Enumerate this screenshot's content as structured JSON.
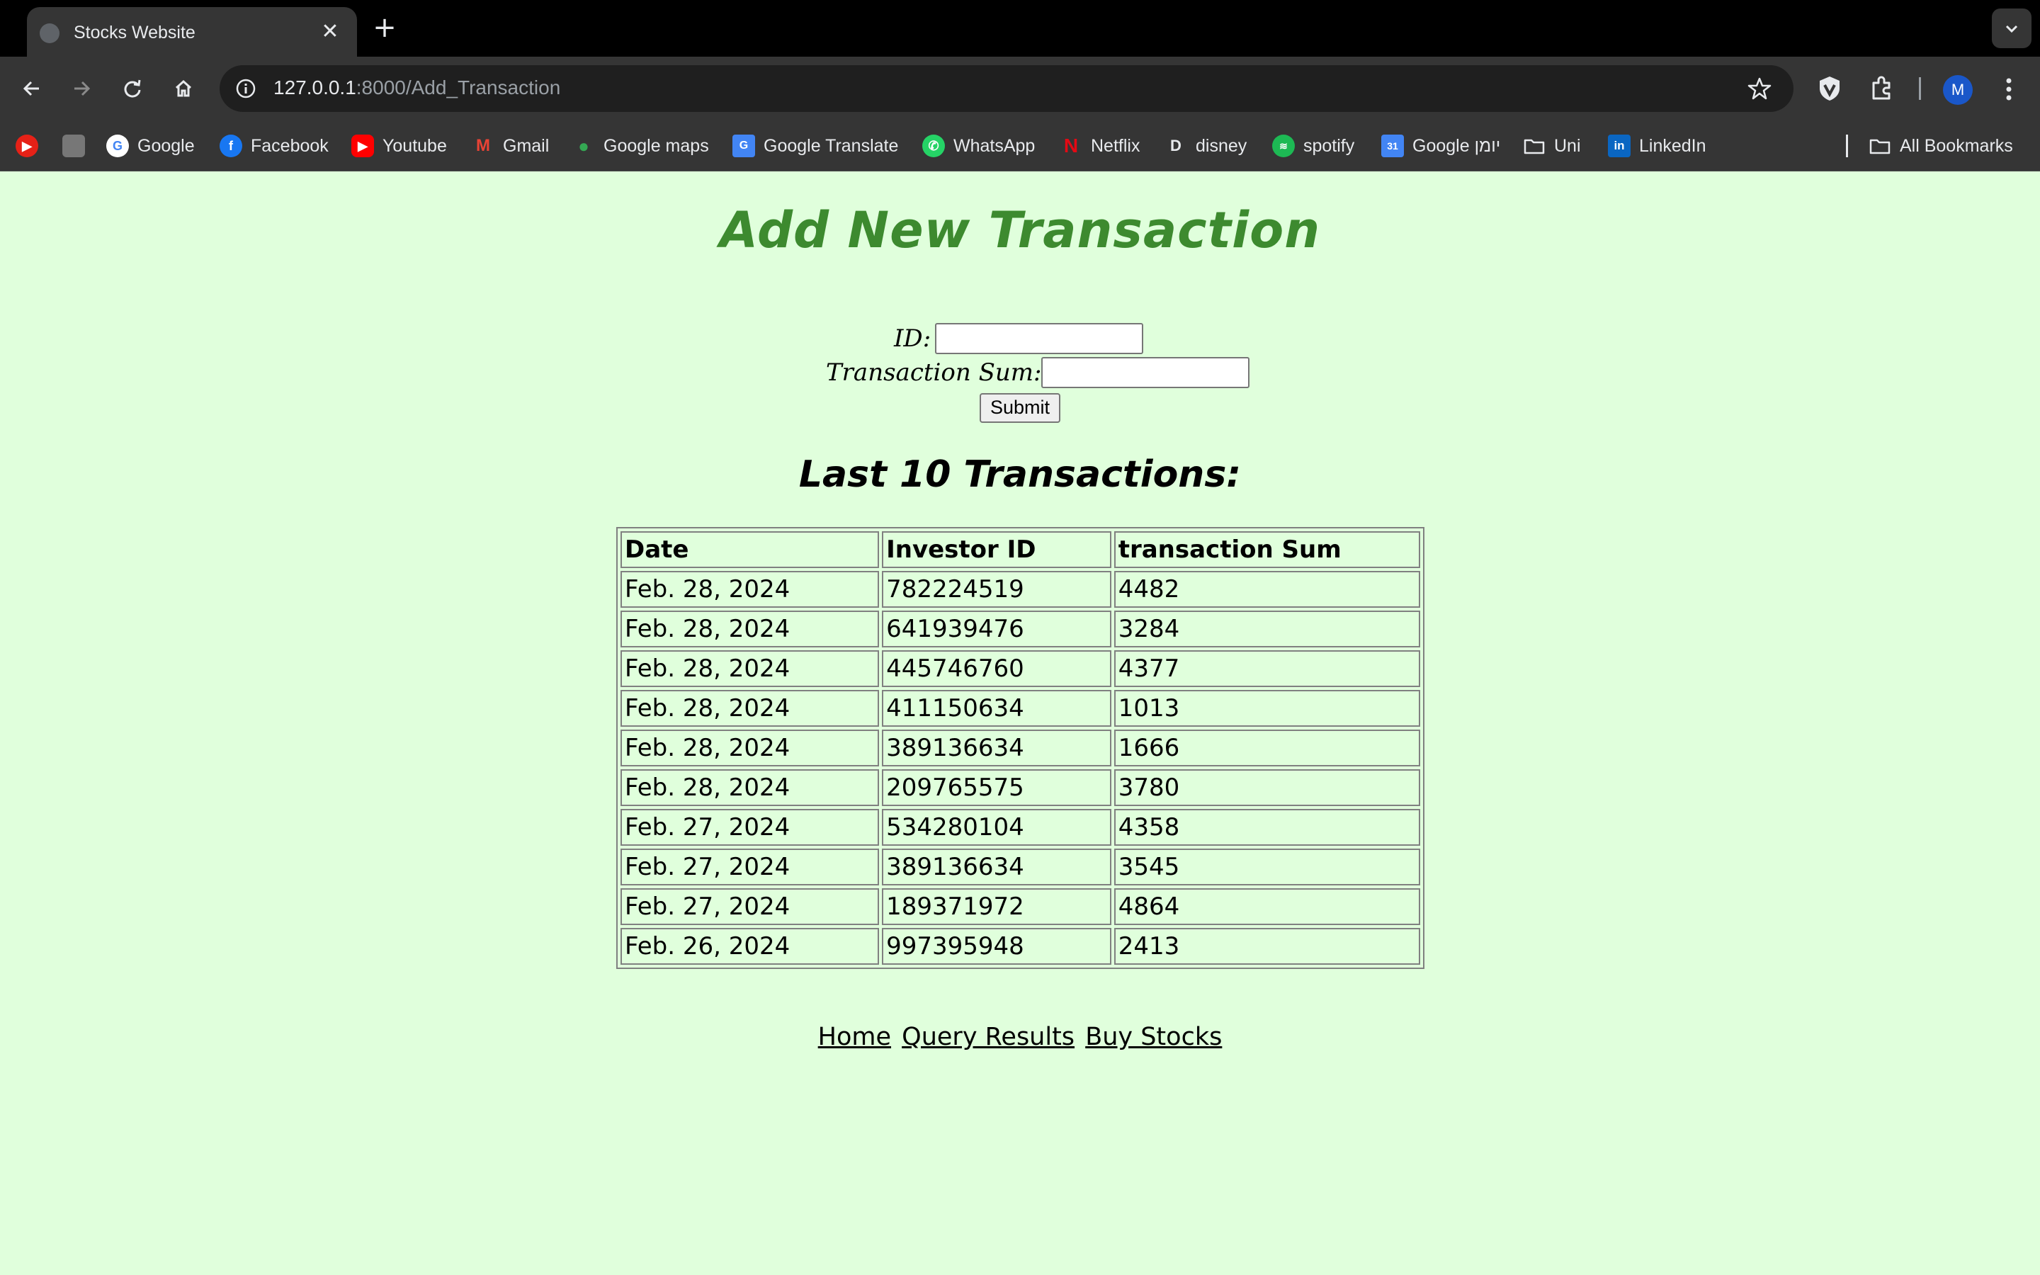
{
  "browser": {
    "tab_title": "Stocks Website",
    "new_tab_label": "+",
    "close_label": "✕",
    "url_host": "127.0.0.1",
    "url_rest": ":8000/Add_Transaction",
    "avatar_initial": "M",
    "bookmarks": [
      {
        "label": "Google",
        "icon": "google-icon"
      },
      {
        "label": "Facebook",
        "icon": "facebook-icon"
      },
      {
        "label": "Youtube",
        "icon": "youtube-icon"
      },
      {
        "label": "Gmail",
        "icon": "gmail-icon"
      },
      {
        "label": "Google maps",
        "icon": "maps-pin-icon"
      },
      {
        "label": "Google Translate",
        "icon": "translate-icon"
      },
      {
        "label": "WhatsApp",
        "icon": "whatsapp-icon"
      },
      {
        "label": "Netflix",
        "icon": "netflix-icon"
      },
      {
        "label": "disney",
        "icon": "disney-icon"
      },
      {
        "label": "spotify",
        "icon": "spotify-icon"
      },
      {
        "label": "Google יומן",
        "icon": "calendar-icon"
      },
      {
        "label": "Uni",
        "icon": "folder-icon"
      },
      {
        "label": "LinkedIn",
        "icon": "linkedin-icon"
      }
    ],
    "all_bookmarks_label": "All Bookmarks"
  },
  "page": {
    "title": "Add New Transaction",
    "form": {
      "id_label": "ID:",
      "id_value": "",
      "sum_label": "Transaction Sum:",
      "sum_value": "",
      "submit_label": "Submit"
    },
    "table_title": "Last 10 Transactions:",
    "table": {
      "headers": [
        "Date",
        "Investor ID",
        "transaction Sum"
      ],
      "rows": [
        [
          "Feb. 28, 2024",
          "782224519",
          "4482"
        ],
        [
          "Feb. 28, 2024",
          "641939476",
          "3284"
        ],
        [
          "Feb. 28, 2024",
          "445746760",
          "4377"
        ],
        [
          "Feb. 28, 2024",
          "411150634",
          "1013"
        ],
        [
          "Feb. 28, 2024",
          "389136634",
          "1666"
        ],
        [
          "Feb. 28, 2024",
          "209765575",
          "3780"
        ],
        [
          "Feb. 27, 2024",
          "534280104",
          "4358"
        ],
        [
          "Feb. 27, 2024",
          "389136634",
          "3545"
        ],
        [
          "Feb. 27, 2024",
          "189371972",
          "4864"
        ],
        [
          "Feb. 26, 2024",
          "997395948",
          "2413"
        ]
      ]
    },
    "footer_links": [
      "Home",
      "Query Results",
      "Buy Stocks"
    ]
  },
  "colors": {
    "page_background": "#e0ffdc",
    "title_green": "#3d8a2f",
    "browser_dark": "#353535"
  }
}
